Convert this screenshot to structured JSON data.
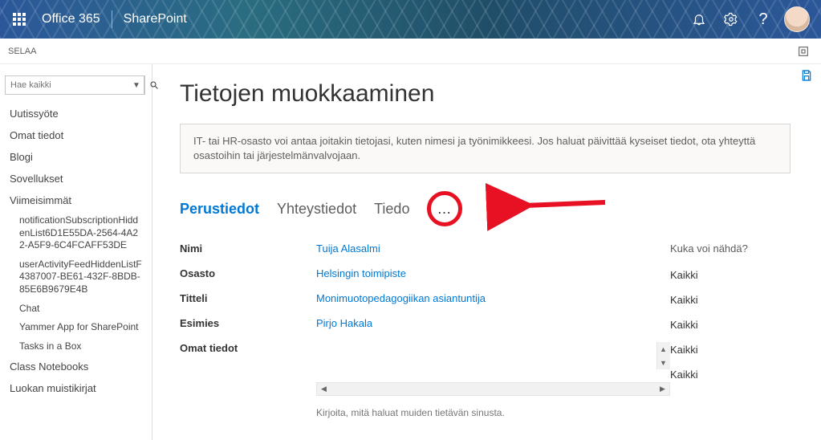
{
  "suite": {
    "brand": "Office 365",
    "site": "SharePoint"
  },
  "ribbon": {
    "browse": "SELAA"
  },
  "search": {
    "placeholder": "Hae kaikki"
  },
  "leftnav": {
    "items": [
      "Uutissyöte",
      "Omat tiedot",
      "Blogi",
      "Sovellukset"
    ],
    "recent_label": "Viimeisimmät",
    "recent": [
      "notificationSubscriptionHiddenList6D1E55DA-2564-4A22-A5F9-6C4FCAFF53DE",
      "userActivityFeedHiddenListF4387007-BE61-432F-8BDB-85E6B9679E4B",
      "Chat",
      "Yammer App for SharePoint",
      "Tasks in a Box"
    ],
    "tail": [
      "Class Notebooks",
      "Luokan muistikirjat"
    ]
  },
  "page": {
    "title": "Tietojen muokkaaminen",
    "info": "IT- tai HR-osasto voi antaa joitakin tietojasi, kuten nimesi ja työnimikkeesi. Jos haluat päivittää kyseiset tiedot, ota yhteyttä osastoihin tai järjestelmänvalvojaan.",
    "tabs": {
      "basic": "Perustiedot",
      "contact": "Yhteystiedot",
      "details": "Tiedo",
      "more": "…"
    },
    "vis_header": "Kuka voi nähdä?",
    "rows": [
      {
        "label": "Nimi",
        "value": "Tuija Alasalmi",
        "visibility": "Kaikki"
      },
      {
        "label": "Osasto",
        "value": "Helsingin toimipiste",
        "visibility": "Kaikki"
      },
      {
        "label": "Titteli",
        "value": "Monimuotopedagogiikan asiantuntija",
        "visibility": "Kaikki"
      },
      {
        "label": "Esimies",
        "value": "Pirjo Hakala",
        "visibility": "Kaikki"
      },
      {
        "label": "Omat tiedot",
        "value": "",
        "visibility": "Kaikki"
      }
    ],
    "helper": "Kirjoita, mitä haluat muiden tietävän sinusta."
  },
  "colors": {
    "accent": "#0078d4",
    "annot": "#e81123"
  }
}
